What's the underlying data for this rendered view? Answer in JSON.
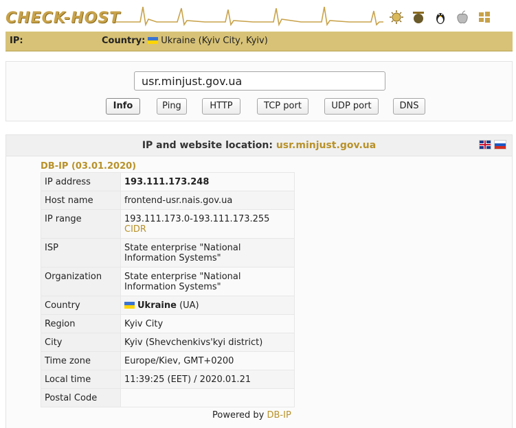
{
  "header": {
    "logo": "CHECK-HOST",
    "os_icons": [
      "sun-icon",
      "tool-icon",
      "linux-icon",
      "apple-icon",
      "windows-icon"
    ]
  },
  "ipbar": {
    "ip_label": "IP:",
    "country_label": "Country:",
    "country_value": "Ukraine (Kyiv City, Kyiv)"
  },
  "search": {
    "value": "usr.minjust.gov.ua",
    "buttons": [
      "Info",
      "Ping",
      "HTTP",
      "TCP port",
      "UDP port",
      "DNS"
    ],
    "active": "Info"
  },
  "result": {
    "title": "IP and website location:",
    "host": "usr.minjust.gov.ua",
    "source_title": "DB-IP (03.01.2020)",
    "rows": {
      "ip_address": {
        "k": "IP address",
        "v": "193.111.173.248"
      },
      "host_name": {
        "k": "Host name",
        "v": "frontend-usr.nais.gov.ua"
      },
      "ip_range": {
        "k": "IP range",
        "v": "193.111.173.0-193.111.173.255",
        "link": "CIDR"
      },
      "isp": {
        "k": "ISP",
        "v1": "State enterprise \"National",
        "v2": "Information Systems\""
      },
      "organization": {
        "k": "Organization",
        "v1": "State enterprise \"National",
        "v2": "Information Systems\""
      },
      "country": {
        "k": "Country",
        "v": "Ukraine",
        "code": "(UA)"
      },
      "region": {
        "k": "Region",
        "v": "Kyiv City"
      },
      "city": {
        "k": "City",
        "v": "Kyiv (Shevchenkivs'kyi district)"
      },
      "time_zone": {
        "k": "Time zone",
        "v": "Europe/Kiev, GMT+0200"
      },
      "local_time": {
        "k": "Local time",
        "v": "11:39:25 (EET) / 2020.01.21"
      },
      "postal_code": {
        "k": "Postal Code",
        "v": ""
      }
    },
    "powered_by": "Powered by",
    "powered_link": "DB-IP"
  }
}
